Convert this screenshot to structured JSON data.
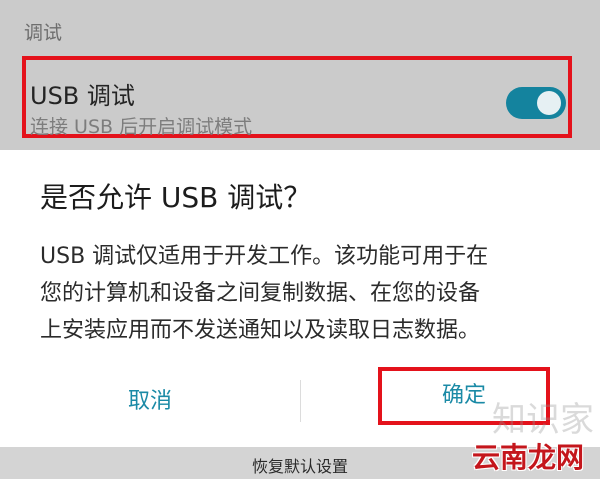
{
  "settings": {
    "section_header": "调试",
    "usb_debugging": {
      "title": "USB 调试",
      "subtitle": "连接 USB 后开启调试模式",
      "enabled": true
    }
  },
  "dialog": {
    "title": "是否允许 USB 调试？",
    "body_lines": [
      "USB 调试仅适用于开发工作。该功能可用于在",
      "您的计算机和设备之间复制数据、在您的设备",
      "上安装应用而不发送通知以及读取日志数据。"
    ],
    "cancel_label": "取消",
    "confirm_label": "确定"
  },
  "bottom_bar": {
    "label": "恢复默认设置"
  },
  "watermark": {
    "faint_text": "知识家",
    "main_text": "云南龙网"
  },
  "colors": {
    "accent": "#1a8aa6",
    "toggle_on": "#14839e",
    "highlight_box": "#e4121b",
    "dim_overlay": "#cbcbcb"
  }
}
